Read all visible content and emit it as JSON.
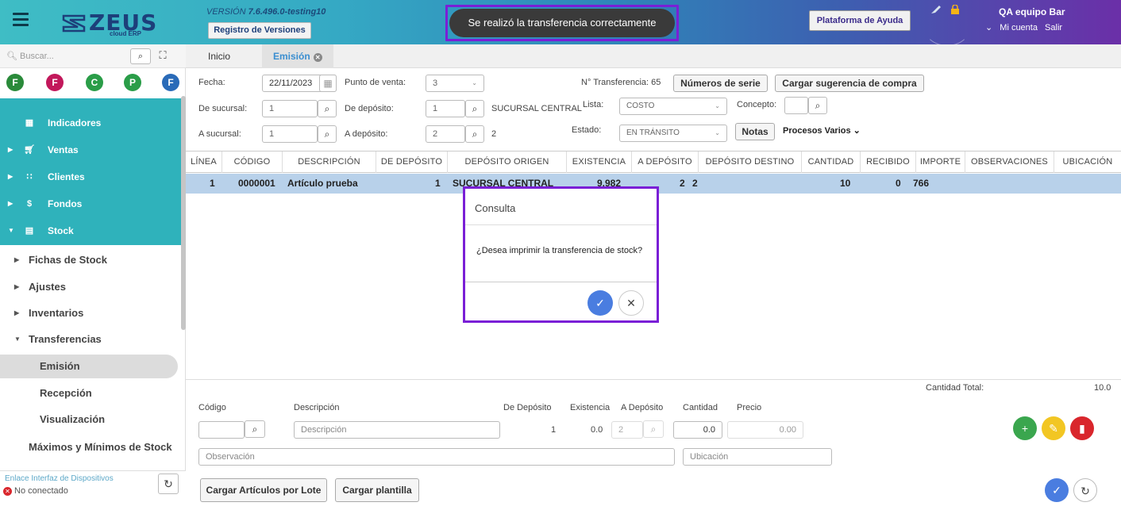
{
  "header": {
    "version_prefix": "VERSIÓN ",
    "version": "7.6.496.0-testing10",
    "changelog_button": "Registro de Versiones",
    "logo_text": "ZEUS",
    "logo_sub": "cloud ERP",
    "toast": "Se realizó la transferencia correctamente",
    "help_button": "Plataforma de Ayuda",
    "user_name": "QA equipo Bar",
    "account_link": "Mi cuenta",
    "logout_link": "Salir"
  },
  "sidebar": {
    "search_placeholder": "Buscar...",
    "favorites": [
      {
        "letter": "F",
        "color": "#2a8a3a"
      },
      {
        "letter": "F",
        "color": "#c2185b"
      },
      {
        "letter": "C",
        "color": "#2a9d48"
      },
      {
        "letter": "P",
        "color": "#2a9d48"
      },
      {
        "letter": "F",
        "color": "#2a6bb8"
      }
    ],
    "menu": [
      {
        "label": "Indicadores"
      },
      {
        "label": "Ventas"
      },
      {
        "label": "Clientes"
      },
      {
        "label": "Fondos"
      },
      {
        "label": "Stock"
      }
    ],
    "stock_items": [
      "Fichas de Stock",
      "Ajustes",
      "Inventarios",
      "Transferencias"
    ],
    "transfer_items": [
      "Emisión",
      "Recepción",
      "Visualización"
    ],
    "extra_item": "Máximos y Mínimos de Stock",
    "device_title": "Enlace Interfaz de Dispositivos",
    "device_status": "No conectado"
  },
  "tabs": {
    "home": "Inicio",
    "active": "Emisión"
  },
  "form": {
    "fecha_label": "Fecha:",
    "fecha": "22/11/2023",
    "punto_venta_label": "Punto de venta:",
    "punto_venta": "3",
    "nro_transferencia_label": "N° Transferencia:",
    "nro_transferencia": "65",
    "numeros_serie_button": "Números de serie",
    "cargar_sugerencia_button": "Cargar sugerencia de compra",
    "de_sucursal_label": "De sucursal:",
    "de_sucursal": "1",
    "de_deposito_label": "De depósito:",
    "de_deposito": "1",
    "de_deposito_name": "SUCURSAL CENTRAL",
    "lista_label": "Lista:",
    "lista": "COSTO",
    "concepto_label": "Concepto:",
    "a_sucursal_label": "A sucursal:",
    "a_sucursal": "1",
    "a_deposito_label": "A depósito:",
    "a_deposito": "2",
    "a_deposito_name": "2",
    "estado_label": "Estado:",
    "estado": "EN TRÁNSITO",
    "notas_button": "Notas",
    "procesos_varios": "Procesos Varios"
  },
  "grid": {
    "headers": [
      "LÍNEA",
      "CÓDIGO",
      "DESCRIPCIÓN",
      "DE DEPÓSITO",
      "DEPÓSITO ORIGEN",
      "EXISTENCIA",
      "A DEPÓSITO",
      "DEPÓSITO DESTINO",
      "CANTIDAD",
      "RECIBIDO",
      "IMPORTE",
      "OBSERVACIONES",
      "UBICACIÓN"
    ],
    "row": {
      "linea": "1",
      "codigo": "0000001",
      "descripcion": "Artículo prueba",
      "de_deposito": "1",
      "deposito_origen": "SUCURSAL CENTRAL",
      "existencia": "9.982",
      "a_deposito": "2",
      "deposito_destino": "2",
      "cantidad": "10",
      "recibido": "0",
      "importe": "766"
    }
  },
  "footer": {
    "cantidad_total_label": "Cantidad Total:",
    "cantidad_total": "10.0",
    "codigo_label": "Código",
    "descripcion_label": "Descripción",
    "de_deposito_label": "De Depósito",
    "existencia_label": "Existencia",
    "a_deposito_label": "A Depósito",
    "cantidad_label": "Cantidad",
    "precio_label": "Precio",
    "descripcion_placeholder": "Descripción",
    "de_deposito_value": "1",
    "existencia_value": "0.0",
    "a_deposito_value": "2",
    "cantidad_value": "0.0",
    "precio_value": "0.00",
    "observacion_placeholder": "Observación",
    "ubicacion_placeholder": "Ubicación",
    "cargar_lote_button": "Cargar Artículos por Lote",
    "cargar_plantilla_button": "Cargar plantilla"
  },
  "dialog": {
    "title": "Consulta",
    "message": "¿Desea imprimir la transferencia de stock?"
  }
}
